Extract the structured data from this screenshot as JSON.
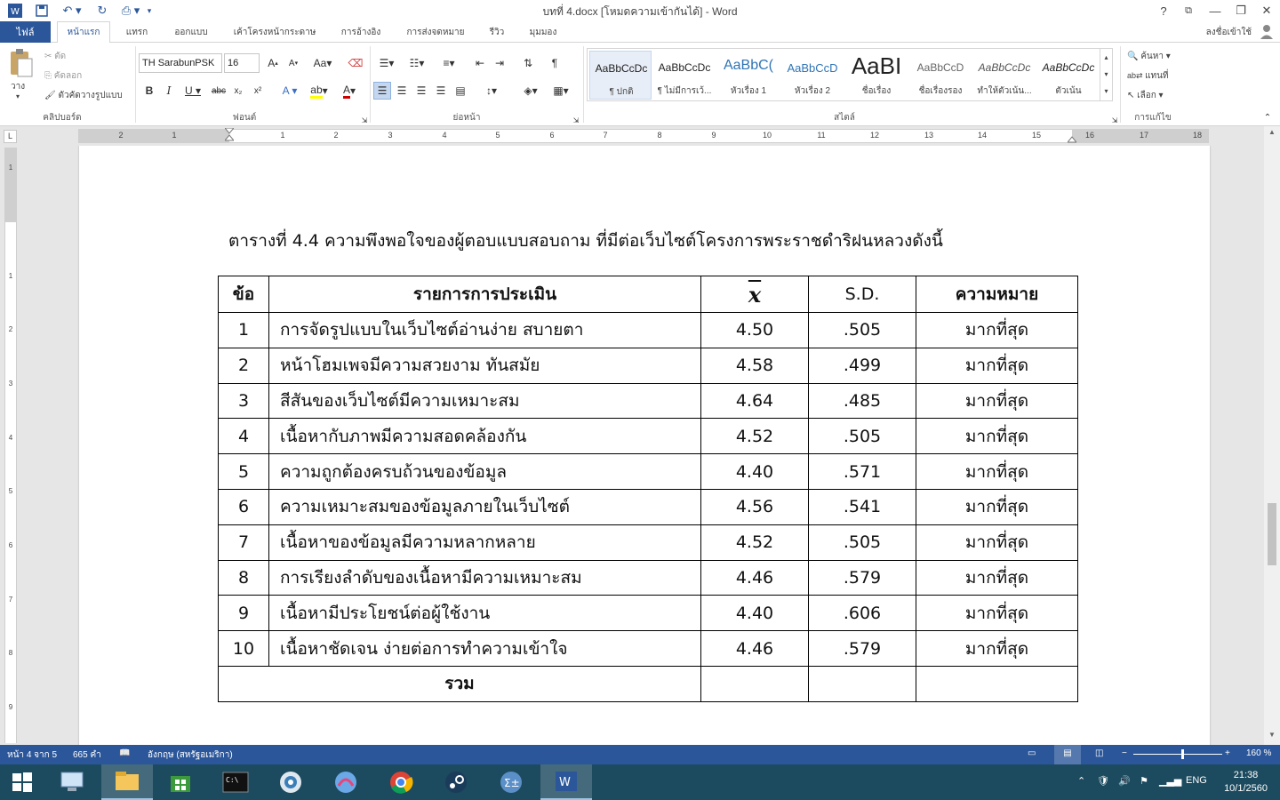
{
  "window": {
    "title": "บทที่ 4.docx [โหมดความเข้ากันได้] - Word",
    "help": "?",
    "minimize": "—",
    "maximize": "❐",
    "close": "✕"
  },
  "tabs": {
    "file": "ไฟล์",
    "items": [
      "หน้าแรก",
      "แทรก",
      "ออกแบบ",
      "เค้าโครงหน้ากระดาษ",
      "การอ้างอิง",
      "การส่งจดหมาย",
      "รีวิว",
      "มุมมอง"
    ],
    "signin": "ลงชื่อเข้าใช้"
  },
  "ribbon": {
    "clipboard": {
      "paste": "วาง",
      "cut": "ตัด",
      "copy": "คัดลอก",
      "format_painter": "ตัวคัดวางรูปแบบ",
      "label": "คลิปบอร์ด"
    },
    "font": {
      "name": "TH SarabunPSK",
      "size": "16",
      "label": "ฟอนต์"
    },
    "paragraph": {
      "label": "ย่อหน้า"
    },
    "styles": {
      "label": "สไตล์",
      "items": [
        {
          "sample": "AaBbCcDc",
          "name": "¶ ปกติ"
        },
        {
          "sample": "AaBbCcDc",
          "name": "¶ ไม่มีการเว้..."
        },
        {
          "sample": "AaBbC(",
          "name": "หัวเรื่อง 1"
        },
        {
          "sample": "AaBbCcD",
          "name": "หัวเรื่อง 2"
        },
        {
          "sample": "AaBI",
          "name": "ชื่อเรื่อง"
        },
        {
          "sample": "AaBbCcD",
          "name": "ชื่อเรื่องรอง"
        },
        {
          "sample": "AaBbCcDc",
          "name": "ทำให้ตัวเน้น..."
        },
        {
          "sample": "AaBbCcDc",
          "name": "ตัวเน้น"
        }
      ]
    },
    "editing": {
      "find": "ค้นหา",
      "replace": "แทนที่",
      "select": "เลือก",
      "label": "การแก้ไข"
    }
  },
  "ruler": {
    "corner": "L",
    "numbers": [
      "2",
      "1",
      "1",
      "2",
      "3",
      "4",
      "5",
      "6",
      "7",
      "8",
      "9",
      "10",
      "11",
      "12",
      "13",
      "14",
      "15",
      "16",
      "17",
      "18"
    ],
    "vnumbers": [
      "1",
      "1",
      "2",
      "3",
      "4",
      "5",
      "6",
      "7",
      "8",
      "9"
    ]
  },
  "document": {
    "caption": "ตารางที่ 4.4 ความพึงพอใจของผู้ตอบแบบสอบถาม ที่มีต่อเว็บไซต์โครงการพระราชดำริฝนหลวงดังนี้",
    "headers": {
      "no": "ข้อ",
      "item": "รายการการประเมิน",
      "mean": "x",
      "sd": "S.D.",
      "meaning": "ความหมาย"
    },
    "rows": [
      {
        "no": "1",
        "item": "การจัดรูปแบบในเว็บไซต์อ่านง่าย สบายตา",
        "mean": "4.50",
        "sd": ".505",
        "meaning": "มากที่สุด"
      },
      {
        "no": "2",
        "item": "หน้าโฮมเพจมีความสวยงาม ทันสมัย",
        "mean": "4.58",
        "sd": ".499",
        "meaning": "มากที่สุด"
      },
      {
        "no": "3",
        "item": "สีสันของเว็บไซต์มีความเหมาะสม",
        "mean": "4.64",
        "sd": ".485",
        "meaning": "มากที่สุด"
      },
      {
        "no": "4",
        "item": "เนื้อหากับภาพมีความสอดคล้องกัน",
        "mean": "4.52",
        "sd": ".505",
        "meaning": "มากที่สุด"
      },
      {
        "no": "5",
        "item": "ความถูกต้องครบถ้วนของข้อมูล",
        "mean": "4.40",
        "sd": ".571",
        "meaning": "มากที่สุด"
      },
      {
        "no": "6",
        "item": "ความเหมาะสมของข้อมูลภายในเว็บไซต์",
        "mean": "4.56",
        "sd": ".541",
        "meaning": "มากที่สุด"
      },
      {
        "no": "7",
        "item": "เนื้อหาของข้อมูลมีความหลากหลาย",
        "mean": "4.52",
        "sd": ".505",
        "meaning": "มากที่สุด"
      },
      {
        "no": "8",
        "item": "การเรียงลำดับของเนื้อหามีความเหมาะสม",
        "mean": "4.46",
        "sd": ".579",
        "meaning": "มากที่สุด"
      },
      {
        "no": "9",
        "item": "เนื้อหามีประโยชน์ต่อผู้ใช้งาน",
        "mean": "4.40",
        "sd": ".606",
        "meaning": "มากที่สุด"
      },
      {
        "no": "10",
        "item": "เนื้อหาชัดเจน ง่ายต่อการทำความเข้าใจ",
        "mean": "4.46",
        "sd": ".579",
        "meaning": "มากที่สุด"
      }
    ],
    "total_label": "รวม"
  },
  "statusbar": {
    "page": "หน้า 4 จาก 5",
    "words": "665 คำ",
    "language": "อังกฤษ (สหรัฐอเมริกา)",
    "zoom": "160 %"
  },
  "taskbar": {
    "lang": "ENG",
    "time": "21:38",
    "date": "10/1/2560"
  },
  "colors": {
    "word_blue": "#2b579a",
    "taskbar": "#1c4a5e"
  }
}
